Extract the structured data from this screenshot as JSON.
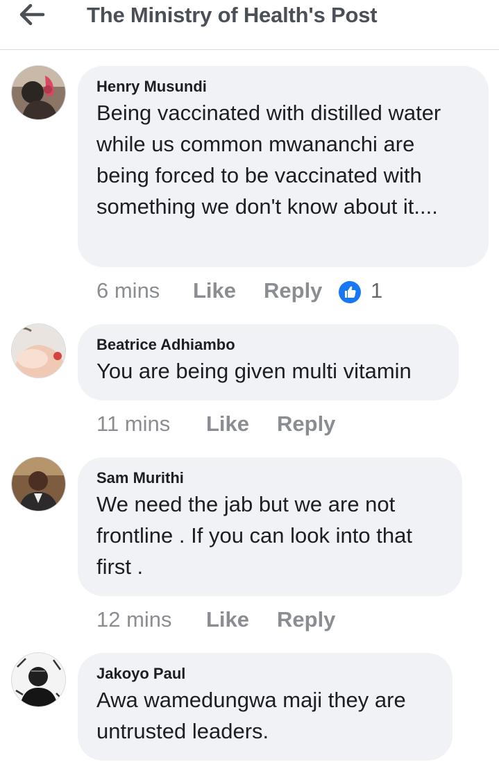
{
  "header": {
    "title": "The Ministry of Health's Post",
    "back_icon": "arrow-left-icon"
  },
  "comments": [
    {
      "author": "Henry Musundi",
      "text": "Being vaccinated with distilled water while us common mwananchi are being forced to be vaccinated with something we don't know about it....",
      "time": "6 mins",
      "like_label": "Like",
      "reply_label": "Reply",
      "reactions": "1",
      "reaction_icon": "thumbs-up-icon"
    },
    {
      "author": "Beatrice Adhiambo",
      "text": "You are being given multi vitamin",
      "time": "11 mins",
      "like_label": "Like",
      "reply_label": "Reply"
    },
    {
      "author": "Sam Murithi",
      "text": "We need the jab but we are not frontline . If you can look into that first .",
      "time": "12 mins",
      "like_label": "Like",
      "reply_label": "Reply"
    },
    {
      "author": "Jakoyo Paul",
      "text": "Awa wamedungwa maji they are untrusted leaders."
    }
  ],
  "colors": {
    "bubble": "#f0f2f5",
    "meta_text": "#8a8d91",
    "like_blue": "#1877f2",
    "title_text": "#4b4f56"
  }
}
